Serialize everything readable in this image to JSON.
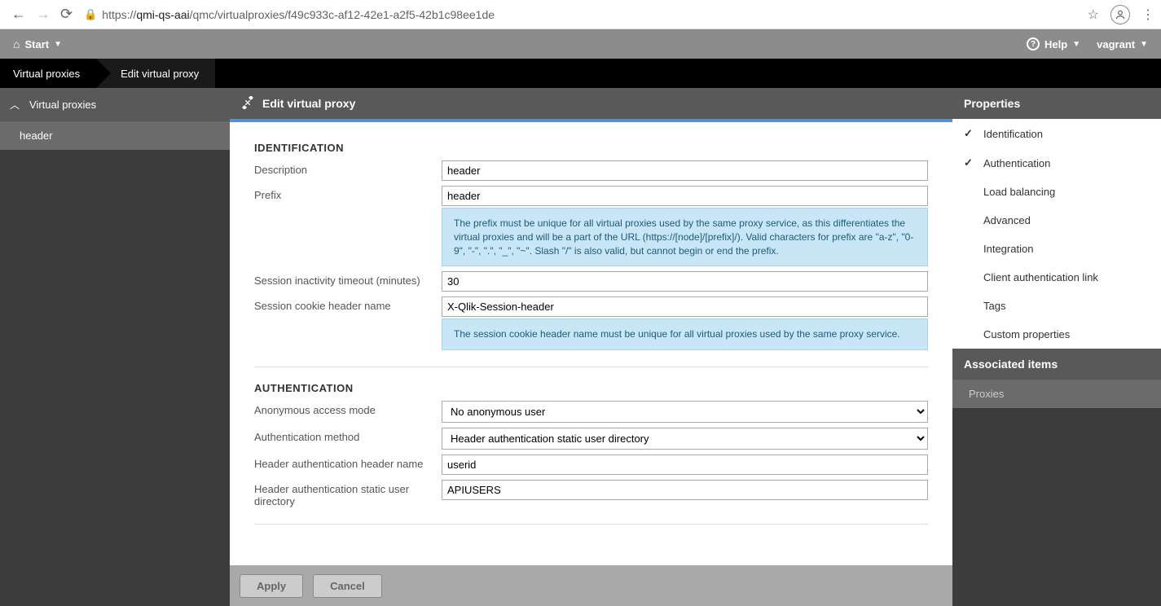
{
  "browser": {
    "url_prefix": "https://",
    "url_host": "qmi-qs-aai",
    "url_path": "/qmc/virtualproxies/f49c933c-af12-42e1-a2f5-42b1c98ee1de"
  },
  "topbar": {
    "start": "Start",
    "help": "Help",
    "user": "vagrant"
  },
  "breadcrumb": {
    "level1": "Virtual proxies",
    "level2": "Edit virtual proxy"
  },
  "sidebar_left": {
    "header": "Virtual proxies",
    "item": "header"
  },
  "edit": {
    "title": "Edit virtual proxy"
  },
  "form": {
    "identification": {
      "title": "IDENTIFICATION",
      "description_label": "Description",
      "description_value": "header",
      "prefix_label": "Prefix",
      "prefix_value": "header",
      "prefix_help": "The prefix must be unique for all virtual proxies used by the same proxy service, as this differentiates the virtual proxies and will be a part of the URL (https://[node]/[prefix]/). Valid characters for prefix are \"a-z\", \"0-9\", \"-\", \".\", \"_\", \"~\". Slash \"/\" is also valid, but cannot begin or end the prefix.",
      "timeout_label": "Session inactivity timeout (minutes)",
      "timeout_value": "30",
      "cookie_label": "Session cookie header name",
      "cookie_value": "X-Qlik-Session-header",
      "cookie_help": "The session cookie header name must be unique for all virtual proxies used by the same proxy service."
    },
    "authentication": {
      "title": "AUTHENTICATION",
      "anon_label": "Anonymous access mode",
      "anon_value": "No anonymous user",
      "method_label": "Authentication method",
      "method_value": "Header authentication static user directory",
      "header_name_label": "Header authentication header name",
      "header_name_value": "userid",
      "static_dir_label": "Header authentication static user directory",
      "static_dir_value": "APIUSERS"
    }
  },
  "buttons": {
    "apply": "Apply",
    "cancel": "Cancel"
  },
  "properties": {
    "title": "Properties",
    "items": [
      {
        "label": "Identification",
        "checked": true
      },
      {
        "label": "Authentication",
        "checked": true
      },
      {
        "label": "Load balancing",
        "checked": false
      },
      {
        "label": "Advanced",
        "checked": false
      },
      {
        "label": "Integration",
        "checked": false
      },
      {
        "label": "Client authentication link",
        "checked": false
      },
      {
        "label": "Tags",
        "checked": false
      },
      {
        "label": "Custom properties",
        "checked": false
      }
    ]
  },
  "associated": {
    "title": "Associated items",
    "item": "Proxies"
  }
}
